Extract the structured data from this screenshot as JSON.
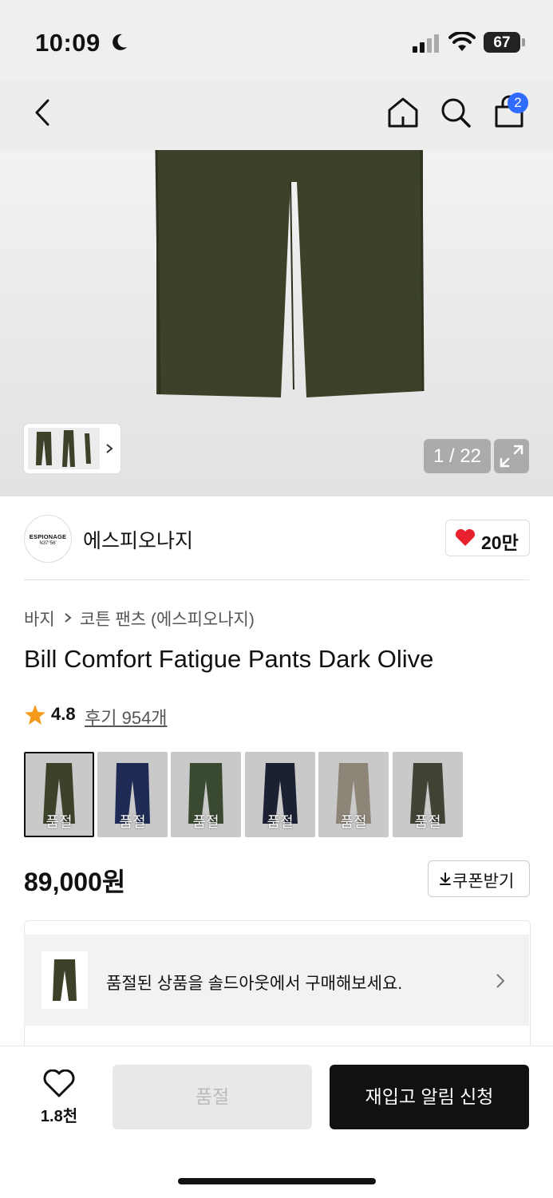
{
  "status": {
    "time": "10:09",
    "battery": "67"
  },
  "cart": {
    "badge": "2"
  },
  "gallery": {
    "counter": "1 / 22"
  },
  "brand": {
    "name": "에스피오나지",
    "logo_text_top": "ESPIONAGE",
    "logo_text_bottom": "N37°56'",
    "likes": "20만"
  },
  "breadcrumb": {
    "category": "바지",
    "sub": "코튼 팬츠 (에스피오나지)"
  },
  "product": {
    "title": "Bill Comfort Fatigue Pants Dark Olive",
    "rating": "4.8",
    "reviews": "후기 954개",
    "price": "89,000원",
    "coupon": "쿠폰받기"
  },
  "swatches": [
    {
      "label": "품절",
      "color": "#3b4229",
      "selected": true
    },
    {
      "label": "품절",
      "color": "#1f2b55"
    },
    {
      "label": "품절",
      "color": "#3a4a31"
    },
    {
      "label": "품절",
      "color": "#1c2033"
    },
    {
      "label": "품절",
      "color": "#8c8578"
    },
    {
      "label": "품절",
      "color": "#3f4435"
    }
  ],
  "soldout_banner": {
    "text": "품절된 상품을 솔드아웃에서 구매해보세요."
  },
  "bottom": {
    "wish_count": "1.8천",
    "soldout_label": "품절",
    "restock_label": "재입고 알림 신청"
  },
  "colors": {
    "olive": "#3b4229",
    "badge_blue": "#2f6bff",
    "heart_red": "#e8212e",
    "star_orange": "#f59a1b"
  }
}
